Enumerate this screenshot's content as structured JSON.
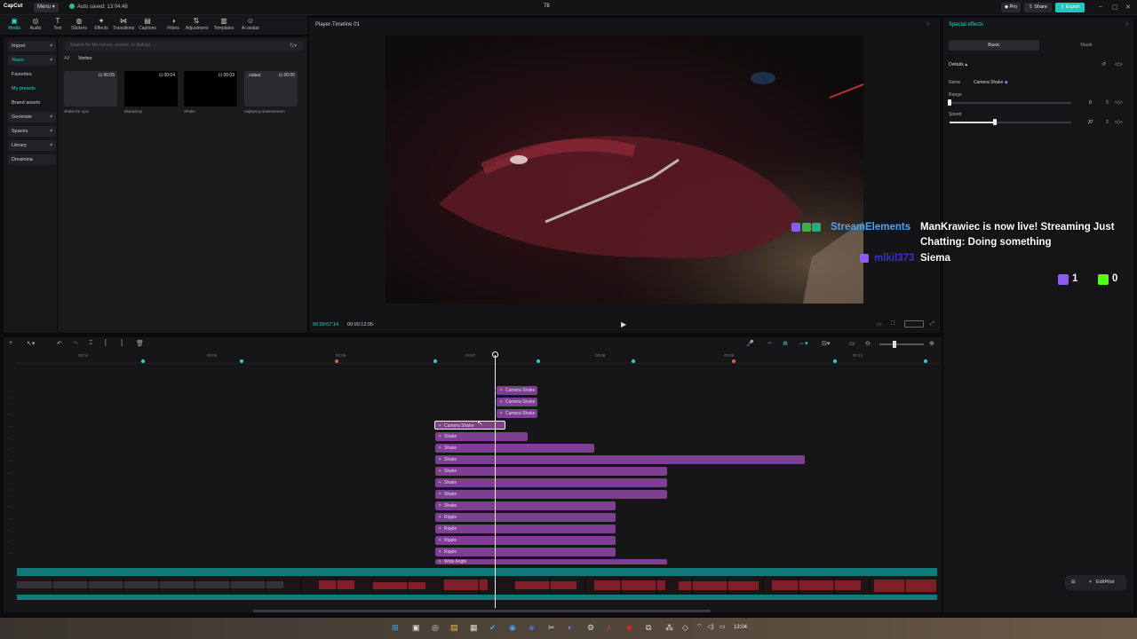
{
  "topbar": {
    "logo": "CapCut",
    "menu_label": "Menu",
    "autosave": "Auto saved: 13:04:48",
    "project_title": "78",
    "pro_label": "Pro",
    "share_label": "Share",
    "export_label": "Export"
  },
  "toolbar": {
    "tools": [
      {
        "label": "Media",
        "icon": "media-icon"
      },
      {
        "label": "Audio",
        "icon": "audio-icon"
      },
      {
        "label": "Text",
        "icon": "text-icon"
      },
      {
        "label": "Stickers",
        "icon": "stickers-icon"
      },
      {
        "label": "Effects",
        "icon": "effects-icon"
      },
      {
        "label": "Transitions",
        "icon": "transitions-icon"
      },
      {
        "label": "Captions",
        "icon": "captions-icon"
      },
      {
        "label": "Filters",
        "icon": "filters-icon"
      },
      {
        "label": "Adjustment",
        "icon": "adjustment-icon"
      },
      {
        "label": "Templates",
        "icon": "templates-icon"
      },
      {
        "label": "AI avatar",
        "icon": "ai-avatar-icon"
      }
    ]
  },
  "leftnav": {
    "items": [
      "Import",
      "Yours",
      "Favorites",
      "My presets",
      "Brand assets",
      "Generate",
      "Spaces",
      "Library",
      "Dreamina"
    ]
  },
  "media": {
    "search_placeholder": "Search for file names, scenes, or dialogs",
    "filter_all": "All",
    "filter_vortex": "Vortex",
    "items": [
      {
        "label": "shake for syni",
        "duration": "00:05",
        "added": ""
      },
      {
        "label": "Blackdrop",
        "duration": "00:04",
        "added": ""
      },
      {
        "label": "Shake",
        "duration": "00:03",
        "added": ""
      },
      {
        "label": "najlepszy shakeeeeem",
        "duration": "00:05",
        "added": "Added"
      }
    ]
  },
  "player": {
    "title": "Player-Timeline 01",
    "time_current": "00:00:07:14",
    "time_total": "00:00:12:05"
  },
  "right_panel": {
    "title": "Special effects",
    "tab_basic": "Basic",
    "tab_mask": "Mask",
    "details_label": "Details",
    "name_label": "Name",
    "name_value": "Camera Shake",
    "range_label": "Range",
    "range_value": "0",
    "speed_label": "Speed",
    "speed_value": "37",
    "range_fraction": 0.0,
    "speed_fraction": 0.37,
    "editpilot_label": "EditPilot"
  },
  "chat_overlay": {
    "line1_name": "StreamElements",
    "line1_text": "ManKrawiec is now live! Streaming Just",
    "line1_cont": "Chatting: Doing something",
    "line2_name": "mlkil373",
    "line2_text": "Siema",
    "count_twitch": "1",
    "count_kick": "0"
  },
  "timeline": {
    "ruler_labels": [
      "00:04",
      "00:05",
      "00:06",
      "00:07",
      "00:08",
      "00:09",
      "00:10"
    ],
    "clips": [
      {
        "label": "Camera Shake",
        "selected": false
      },
      {
        "label": "Camera Shake",
        "selected": false
      },
      {
        "label": "Camera Shake",
        "selected": false
      },
      {
        "label": "Camera Shake",
        "selected": true
      },
      {
        "label": "Shake",
        "selected": false
      },
      {
        "label": "Shake",
        "selected": false
      },
      {
        "label": "Shake",
        "selected": false
      },
      {
        "label": "Shake",
        "selected": false
      },
      {
        "label": "Shake",
        "selected": false
      },
      {
        "label": "Shake",
        "selected": false
      },
      {
        "label": "Shake",
        "selected": false
      },
      {
        "label": "Ripple",
        "selected": false
      },
      {
        "label": "Ripple",
        "selected": false
      },
      {
        "label": "Ripple",
        "selected": false
      },
      {
        "label": "Ripple",
        "selected": false
      },
      {
        "label": "Wide Angle",
        "selected": false
      }
    ]
  },
  "taskbar": {
    "clock": "13:04"
  },
  "colors": {
    "accent": "#27d3ce",
    "clip_purple": "#7d3f92",
    "export_teal": "#1ec7c1"
  }
}
